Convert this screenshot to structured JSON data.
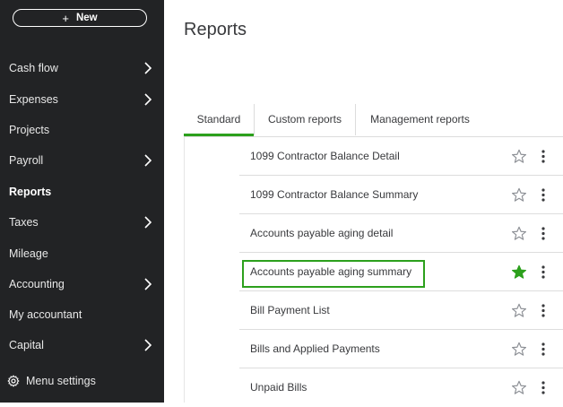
{
  "sidebar": {
    "new_label": "New",
    "items": [
      {
        "label": "Cash flow",
        "chevron": true
      },
      {
        "label": "Expenses",
        "chevron": true
      },
      {
        "label": "Projects",
        "chevron": false
      },
      {
        "label": "Payroll",
        "chevron": true
      },
      {
        "label": "Reports",
        "chevron": false,
        "active": true
      },
      {
        "label": "Taxes",
        "chevron": true
      },
      {
        "label": "Mileage",
        "chevron": false
      },
      {
        "label": "Accounting",
        "chevron": true
      },
      {
        "label": "My accountant",
        "chevron": false
      },
      {
        "label": "Capital",
        "chevron": true
      }
    ],
    "menu_settings_label": "Menu settings"
  },
  "header": {
    "title": "Reports"
  },
  "tabs": [
    {
      "label": "Standard",
      "active": true
    },
    {
      "label": "Custom reports",
      "active": false
    },
    {
      "label": "Management reports",
      "active": false
    }
  ],
  "reports": [
    {
      "name": "1099 Contractor Balance Detail",
      "favorite": false
    },
    {
      "name": "1099 Contractor Balance Summary",
      "favorite": false
    },
    {
      "name": "Accounts payable aging detail",
      "favorite": false
    },
    {
      "name": "Accounts payable aging summary",
      "favorite": true,
      "highlighted": true
    },
    {
      "name": "Bill Payment List",
      "favorite": false
    },
    {
      "name": "Bills and Applied Payments",
      "favorite": false
    },
    {
      "name": "Unpaid Bills",
      "favorite": false
    }
  ],
  "colors": {
    "sidebar_bg": "#222325",
    "accent_green": "#2ca01c",
    "text": "#393a3d"
  }
}
